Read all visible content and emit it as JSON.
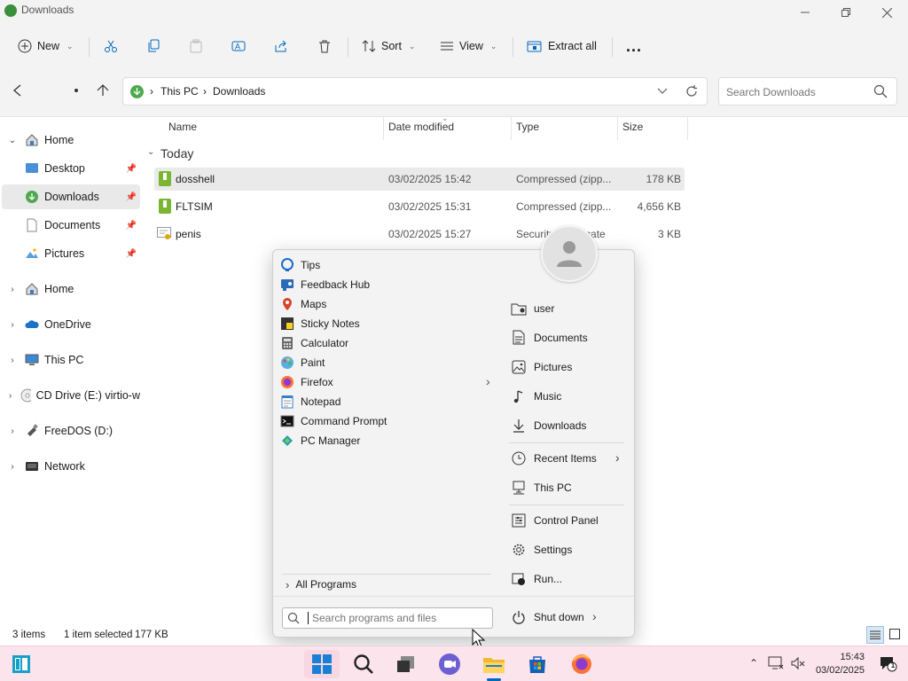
{
  "window": {
    "title": "Downloads"
  },
  "toolbar": {
    "new": "New",
    "sort": "Sort",
    "view": "View",
    "extract_all": "Extract all",
    "more": "..."
  },
  "address": {
    "crumbs": [
      "This PC",
      "Downloads"
    ],
    "search_placeholder": "Search Downloads"
  },
  "sidebar": {
    "quick": [
      {
        "label": "Home"
      },
      {
        "label": "Desktop"
      },
      {
        "label": "Downloads"
      },
      {
        "label": "Documents"
      },
      {
        "label": "Pictures"
      }
    ],
    "tree": [
      {
        "label": "Home"
      },
      {
        "label": "OneDrive"
      },
      {
        "label": "This PC"
      },
      {
        "label": "CD Drive (E:) virtio-w"
      },
      {
        "label": "FreeDOS (D:)"
      },
      {
        "label": "Network"
      }
    ]
  },
  "files": {
    "columns": {
      "name": "Name",
      "date": "Date modified",
      "type": "Type",
      "size": "Size"
    },
    "group": "Today",
    "rows": [
      {
        "name": "dosshell",
        "date": "03/02/2025 15:42",
        "type": "Compressed (zipp...",
        "size": "178 KB"
      },
      {
        "name": "FLTSIM",
        "date": "03/02/2025 15:31",
        "type": "Compressed (zipp...",
        "size": "4,656 KB"
      },
      {
        "name": "penis",
        "date": "03/02/2025 15:27",
        "type": "Security Certificate",
        "size": "3 KB"
      }
    ]
  },
  "status": {
    "items": "3 items",
    "selected": "1 item selected",
    "selsize": "177 KB"
  },
  "startmenu": {
    "programs": [
      "Tips",
      "Feedback Hub",
      "Maps",
      "Sticky Notes",
      "Calculator",
      "Paint",
      "Firefox",
      "Notepad",
      "Command Prompt",
      "PC Manager"
    ],
    "all_programs": "All Programs",
    "search_placeholder": "Search programs and files",
    "places": [
      "user",
      "Documents",
      "Pictures",
      "Music",
      "Downloads",
      "Recent Items",
      "This PC",
      "Control Panel",
      "Settings",
      "Run..."
    ],
    "shutdown": "Shut down"
  },
  "tray": {
    "time": "15:43",
    "date": "03/02/2025",
    "notifications": "1"
  },
  "colors": {
    "taskbar": "#fce4ec",
    "accent": "#0067c0",
    "zip_green": "#7bb531"
  }
}
